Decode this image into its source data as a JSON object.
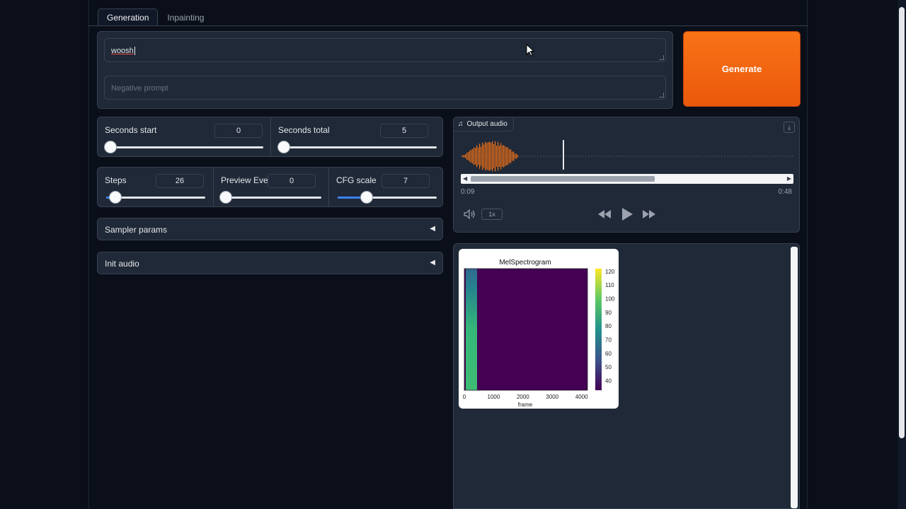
{
  "tabs": [
    {
      "label": "Generation",
      "active": true
    },
    {
      "label": "Inpainting",
      "active": false
    }
  ],
  "prompt": {
    "value": "woosh",
    "placeholder": ""
  },
  "negative_prompt": {
    "value": "",
    "placeholder": "Negative prompt"
  },
  "generate_label": "Generate",
  "sliders_row1": [
    {
      "label": "Seconds start",
      "value": "0",
      "fraction": 0.0
    },
    {
      "label": "Seconds total",
      "value": "5",
      "fraction": 0.0
    }
  ],
  "sliders_row2": [
    {
      "label": "Steps",
      "value": "26",
      "fraction": 0.02
    },
    {
      "label": "Preview Every",
      "value": "0",
      "fraction": 0.0
    },
    {
      "label": "CFG scale",
      "value": "7",
      "fraction": 0.3
    }
  ],
  "accordions": [
    {
      "label": "Sampler params",
      "arrow": "◀"
    },
    {
      "label": "Init audio",
      "arrow": "◀"
    }
  ],
  "audio": {
    "label": "Output audio",
    "current_time": "0:09",
    "duration": "0:48",
    "playback_rate": "1x",
    "progress": 0.3
  },
  "spectrogram": {
    "title": "MelSpectrogram",
    "xlabel": "frame",
    "x_ticks": [
      "0",
      "1000",
      "2000",
      "3000",
      "4000"
    ],
    "colorbar_ticks": [
      "120",
      "110",
      "100",
      "90",
      "80",
      "70",
      "60",
      "50",
      "40"
    ]
  },
  "colors": {
    "accent": "#f97316",
    "background": "#0b0f19",
    "panel": "#1f2937",
    "slider_fill": "#3b82f6",
    "waveform": "#f97316",
    "spectro_bg": "#440154",
    "spectro_band": "#35b779"
  }
}
